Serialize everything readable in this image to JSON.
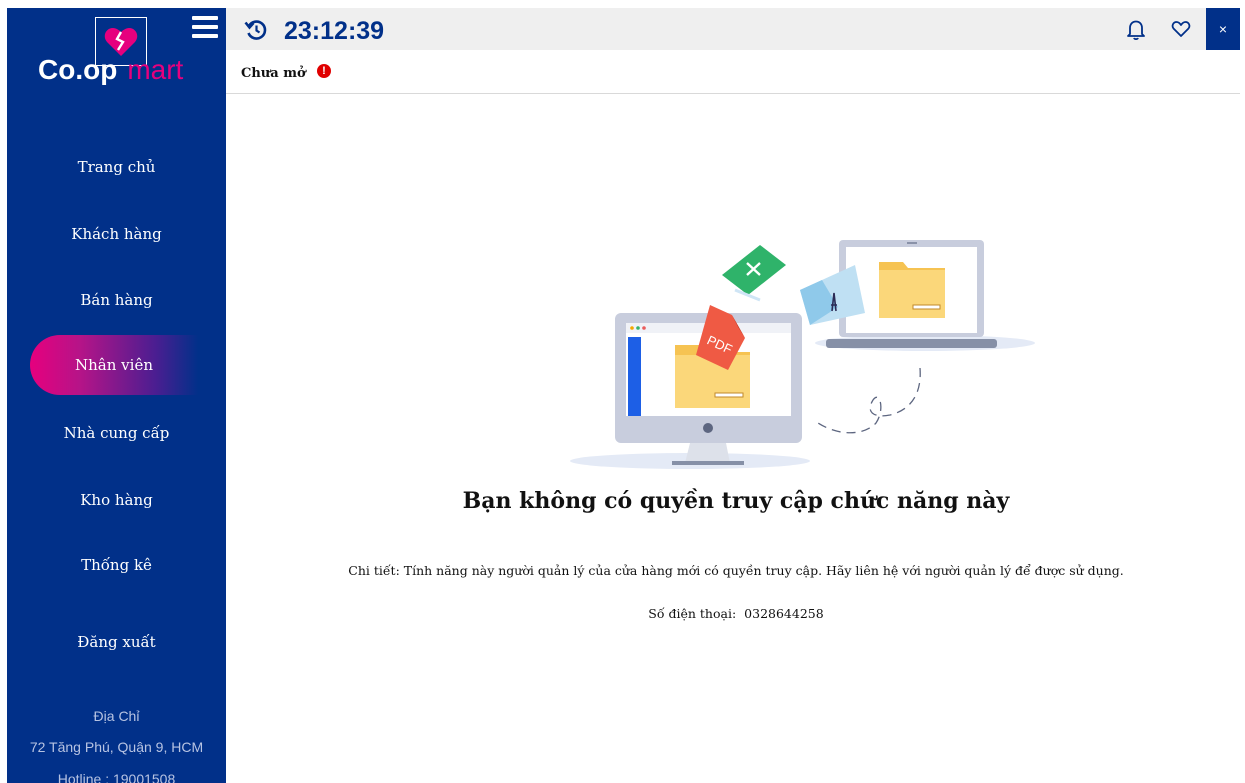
{
  "sidebar": {
    "brand": {
      "part1": "Co.op",
      "part2": "mart"
    },
    "nav_items": [
      {
        "label": "Trang chủ"
      },
      {
        "label": "Khách hàng"
      },
      {
        "label": "Bán hàng"
      },
      {
        "label": "Nhân viên",
        "active": true
      },
      {
        "label": "Nhà cung cấp"
      },
      {
        "label": "Kho hàng"
      },
      {
        "label": "Thống kê"
      },
      {
        "label": "Đăng xuất"
      }
    ],
    "address_title": "Địa Chỉ",
    "address": "72 Tăng Phú, Quận 9, HCM",
    "hotline": "Hotline : 19001508"
  },
  "topbar": {
    "clock": "23:12:39",
    "close_label": "×"
  },
  "status": {
    "label": "Chưa mở",
    "alert_glyph": "!"
  },
  "main": {
    "title": "Bạn không có quyền truy cập chức năng này",
    "detail": "Chi tiết: Tính năng này người quản lý của cửa hàng mới có quyền truy cập. Hãy liên hệ với người quản lý để được sử dụng.",
    "phone_label": "Số điện thoại:",
    "phone_value": "0328644258",
    "pdf_label": "PDF"
  },
  "colors": {
    "sidebar_bg": "#013089",
    "accent_pink": "#e6007e",
    "clock_color": "#013089",
    "alert_red": "#e00000",
    "topbar_bg": "#efefef"
  },
  "icons": [
    "broken-heart-icon",
    "hamburger-menu-icon",
    "history-icon",
    "bell-icon",
    "heart-outline-icon",
    "close-icon",
    "alert-icon"
  ]
}
